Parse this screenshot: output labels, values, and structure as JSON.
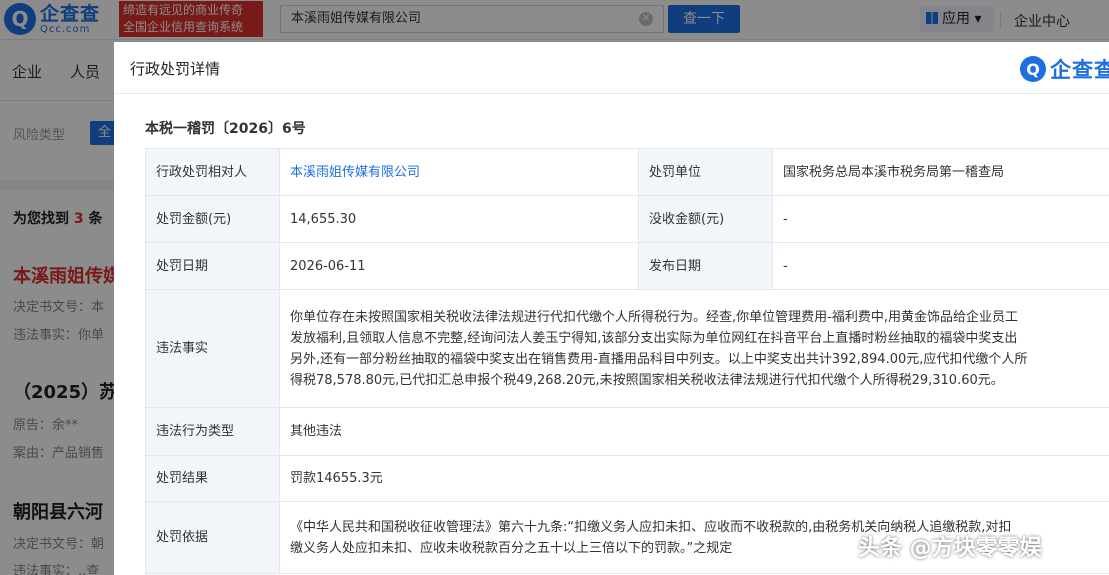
{
  "header": {
    "logo_cn": "企查查",
    "logo_en": "Qcc.com",
    "slogan_line1": "缔造有远见的商业传奇",
    "slogan_line2": "全国企业信用查询系统",
    "search_value": "本溪雨姐传媒有限公司",
    "search_button": "查一下",
    "app_menu": "应用",
    "user_center": "企业中心"
  },
  "nav": {
    "item1": "企业",
    "item2": "人员"
  },
  "filter": {
    "label": "风险类型",
    "chip": "全"
  },
  "background_results": {
    "count_prefix": "为您找到",
    "count": "3",
    "count_suffix": "条",
    "row1_title": "本溪雨姐传媒",
    "row1_meta1": "决定书文号：本",
    "row1_meta2": "违法事实：你单",
    "row2_title": "（2025）苏",
    "row2_meta1": "原告：余**",
    "row2_meta2": "案由：产品销售",
    "row3_title": "朝阳县六河",
    "row3_meta1": "决定书文号：朝",
    "row3_meta2": "违法事实：..查"
  },
  "modal": {
    "title": "行政处罚详情",
    "logo_text": "企查查",
    "doc_no": "本税一稽罚〔2026〕6号",
    "rows": {
      "party_label": "行政处罚相对人",
      "party_value": "本溪雨姐传媒有限公司",
      "unit_label": "处罚单位",
      "unit_value": "国家税务总局本溪市税务局第一稽查局",
      "amount_label": "处罚金额(元)",
      "amount_value": "14,655.30",
      "confiscate_label": "没收金额(元)",
      "confiscate_value": "-",
      "date_label": "处罚日期",
      "date_value": "2026-06-11",
      "publish_label": "发布日期",
      "publish_value": "-",
      "facts_label": "违法事实",
      "facts_line1": "你单位存在未按照国家相关税收法律法规进行代扣代缴个人所得税行为。经查,你单位管理费用-福利费中,用黄金饰品给企业员工",
      "facts_line2": "发放福利,且领取人信息不完整,经询问法人姜玉宁得知,该部分支出实际为单位网红在抖音平台上直播时粉丝抽取的福袋中奖支出",
      "facts_line3": "另外,还有一部分粉丝抽取的福袋中奖支出在销售费用-直播用品科目中列支。以上中奖支出共计392,894.00元,应代扣代缴个人所",
      "facts_line4": "得税78,578.80元,已代扣汇总申报个税49,268.20元,未按照国家相关税收法律法规进行代扣代缴个人所得税29,310.60元。",
      "type_label": "违法行为类型",
      "type_value": "其他违法",
      "result_label": "处罚结果",
      "result_value": "罚款14655.3元",
      "basis_label": "处罚依据",
      "basis_line1": "《中华人民共和国税收征收管理法》第六十九条:“扣缴义务人应扣未扣、应收而不收税款的,由税务机关向纳税人追缴税款,对扣",
      "basis_line2": "缴义务人处应扣未扣、应收未收税款百分之五十以上三倍以下的罚款。”之规定"
    }
  },
  "watermark": "头条 @方块零零娱"
}
